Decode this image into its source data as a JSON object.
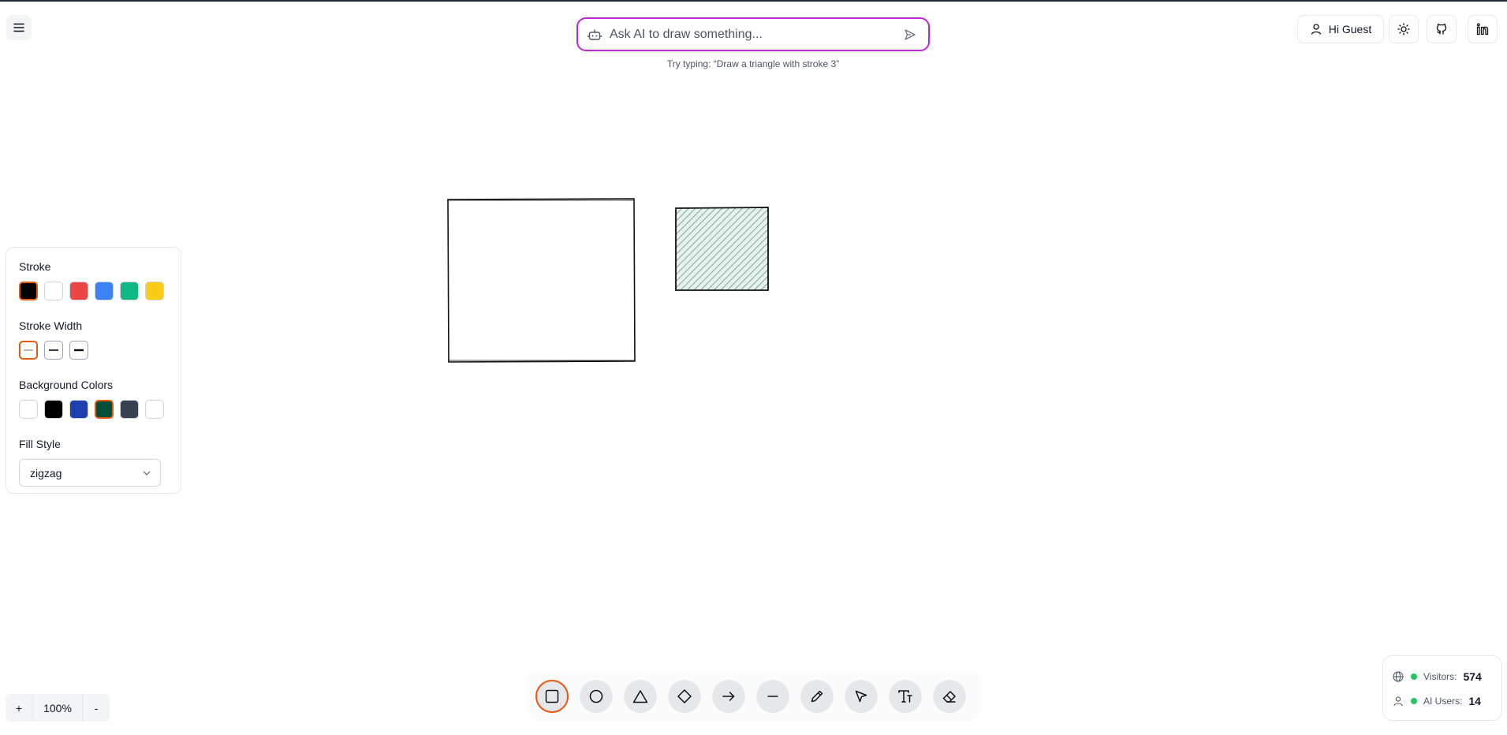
{
  "ai": {
    "placeholder": "Ask AI to draw something...",
    "hint": "Try typing: “Draw a triangle with stroke 3”"
  },
  "header": {
    "guest_label": "Hi Guest"
  },
  "panel": {
    "stroke_title": "Stroke",
    "stroke_colors": [
      "#000000",
      "#ffffff",
      "#ef4444",
      "#3b82f6",
      "#10b981",
      "#facc15"
    ],
    "stroke_width_title": "Stroke Width",
    "background_title": "Background Colors",
    "background_colors": [
      "#ffffff",
      "#000000",
      "#1e40af",
      "#064e3b",
      "#374151",
      "#ffffff"
    ],
    "fill_style_title": "Fill Style",
    "fill_style_value": "zigzag"
  },
  "toolbar": {
    "tools": [
      "rectangle-icon",
      "circle-icon",
      "triangle-icon",
      "diamond-icon",
      "arrow-icon",
      "line-icon",
      "pencil-icon",
      "select-icon",
      "text-icon",
      "eraser-icon"
    ]
  },
  "zoom": {
    "plus": "+",
    "value": "100%",
    "minus": "-"
  },
  "stats": {
    "visitors_label": "Visitors:",
    "visitors_value": "574",
    "ai_users_label": "AI Users:",
    "ai_users_value": "14"
  }
}
